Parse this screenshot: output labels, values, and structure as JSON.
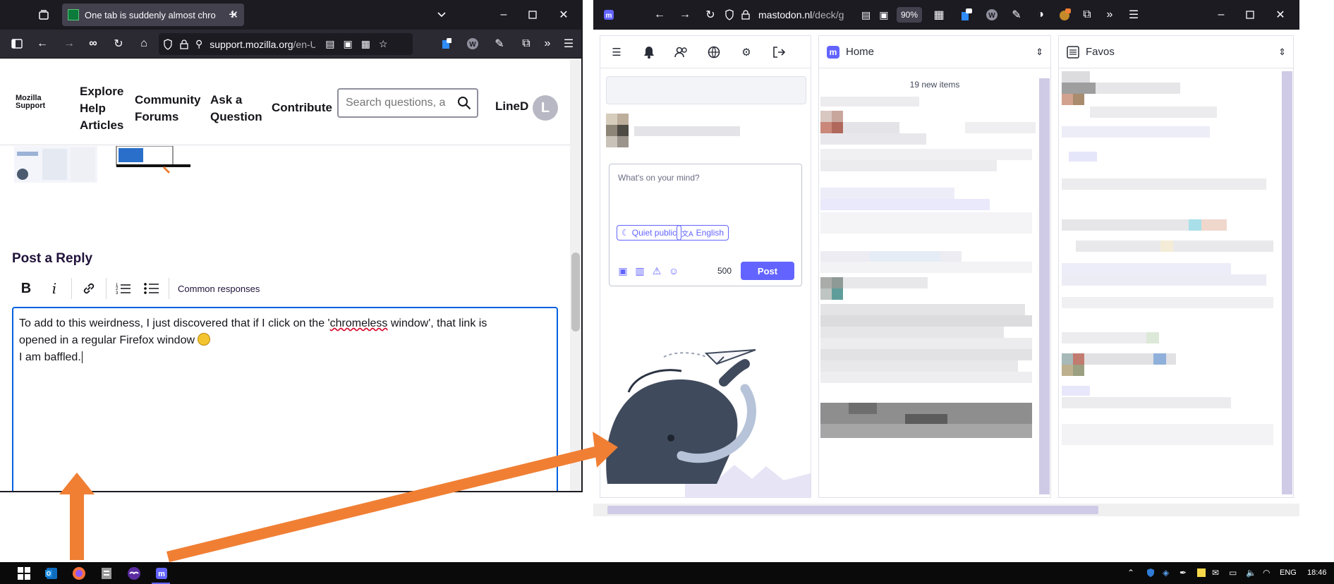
{
  "firefox": {
    "tab_title": "One tab is suddenly almost chro",
    "url_domain": "support.mozilla.org",
    "url_path": "/en-U",
    "site": {
      "logo_line1": "Mozilla",
      "logo_line2": "Support",
      "nav": [
        "Explore Help Articles",
        "Community Forums",
        "Ask a Question",
        "Contribute"
      ],
      "search_placeholder": "Search questions, a",
      "user_name": "LineD",
      "user_initial": "L"
    },
    "reply": {
      "title": "Post a Reply",
      "toolbar": {
        "bold": "B",
        "italic": "i",
        "common_responses": "Common responses"
      },
      "text_line1_a": "To add to this weirdness, I just discovered that if I click on the '",
      "text_line1_misspelled": "chromeless",
      "text_line1_b": " window', that link is",
      "text_line2": "opened in a regular Firefox window",
      "text_line3": "I am baffled."
    }
  },
  "mastodon": {
    "url_domain": "mastodon.nl",
    "url_path": "/deck/g",
    "zoom": "90%",
    "badge_count": "0",
    "compose": {
      "placeholder": "What's on your mind?",
      "visibility": "Quiet public",
      "language": "English",
      "char_count": "500",
      "post_label": "Post"
    },
    "columns": {
      "home": {
        "title": "Home",
        "new_items": "19 new items"
      },
      "favs": {
        "title": "Favos"
      }
    }
  },
  "taskbar": {
    "language": "ENG",
    "time": "18:46"
  },
  "colors": {
    "accent": "#6364ff",
    "arrow": "#f07f34",
    "focus": "#0060df"
  }
}
